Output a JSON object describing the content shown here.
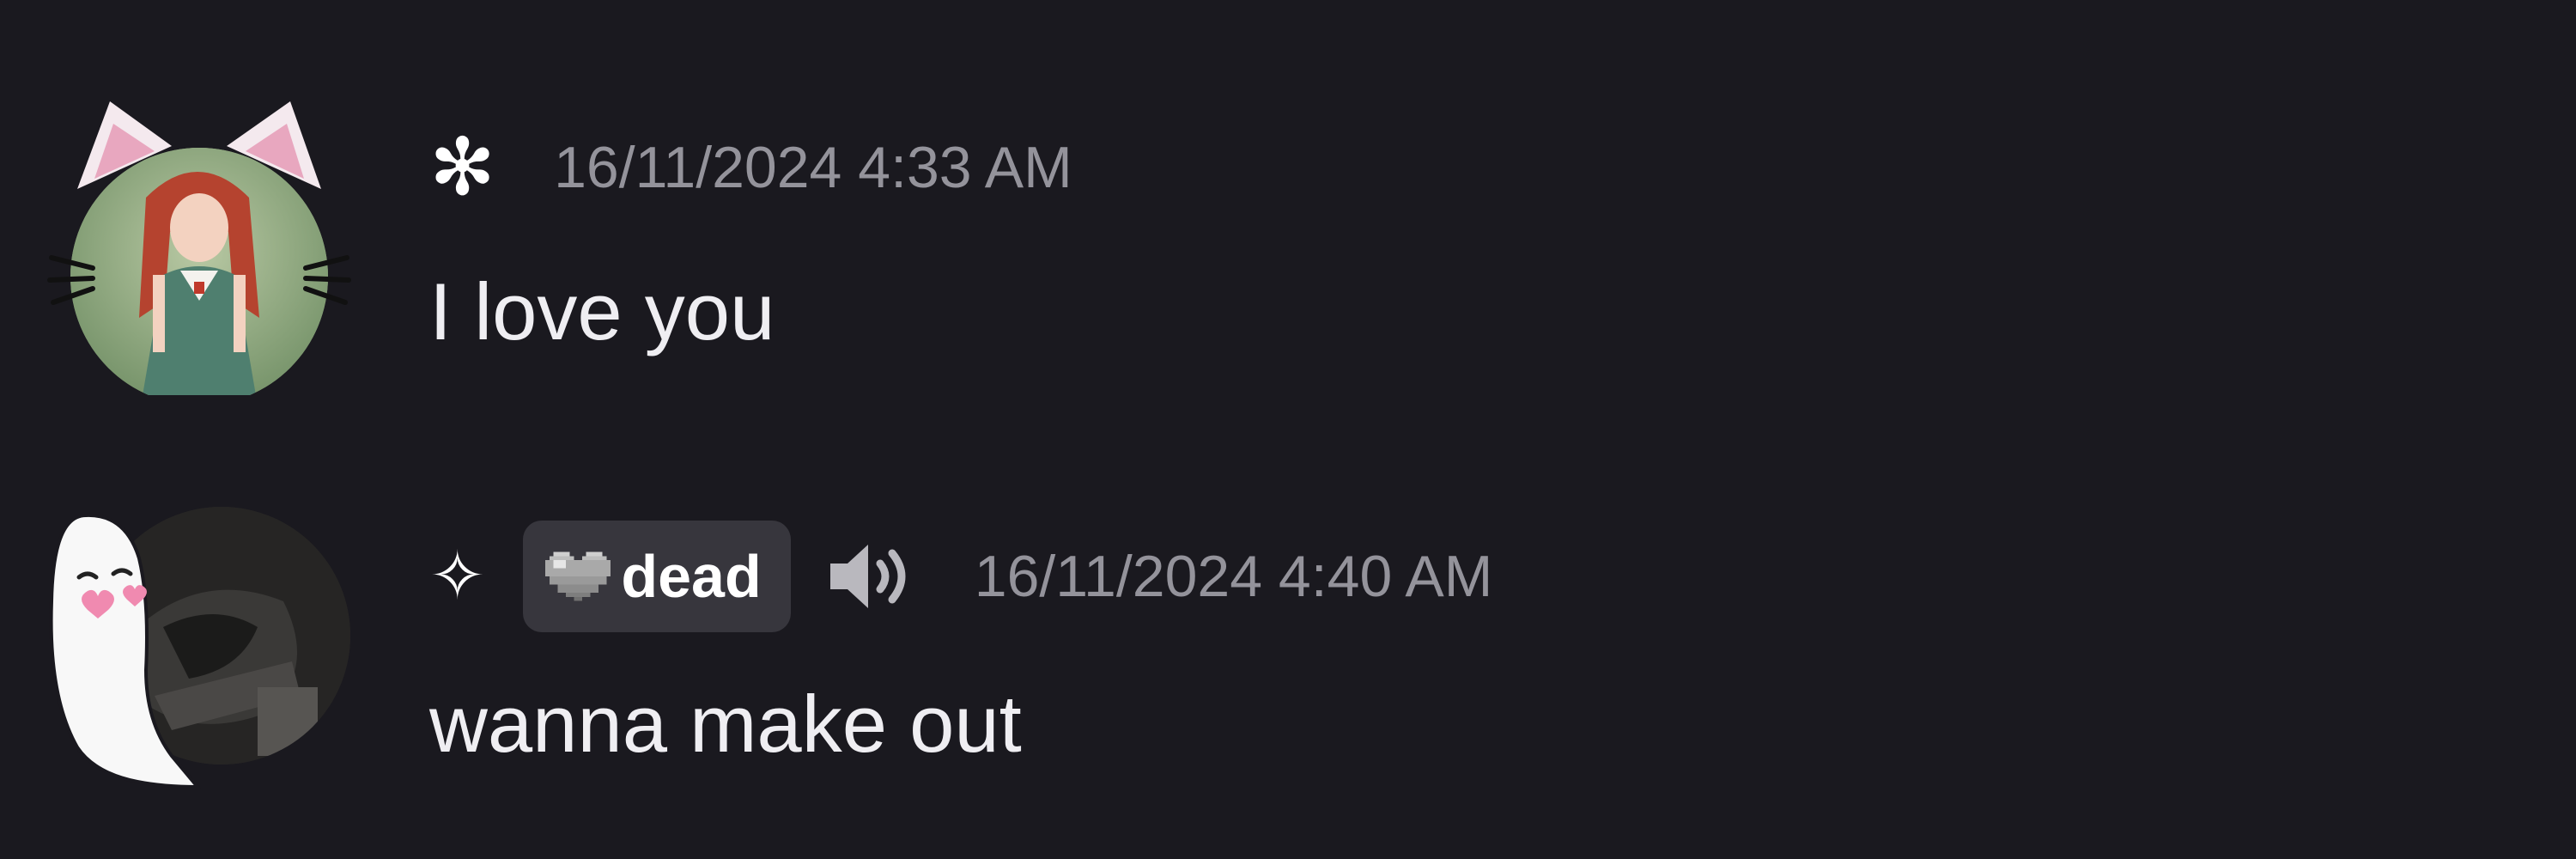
{
  "messages": [
    {
      "username": "✻",
      "username_icon": "asterisk-flower-icon",
      "avatar_icon": "cat-ears-anime-girl-avatar",
      "timestamp": "16/11/2024 4:33 AM",
      "text": "I love you"
    },
    {
      "username": "✧",
      "username_icon": "four-point-sparkle-icon",
      "avatar_icon": "ghost-dark-photo-avatar",
      "tag": {
        "icon": "pixel-heart-icon",
        "label": "dead"
      },
      "status_icon": "speaker-icon",
      "timestamp": "16/11/2024 4:40 AM",
      "text": "wanna make out"
    }
  ],
  "colors": {
    "background": "#1a191f",
    "timestamp": "#94939b",
    "message_text": "#efeef2",
    "tag_background": "#37363d"
  }
}
